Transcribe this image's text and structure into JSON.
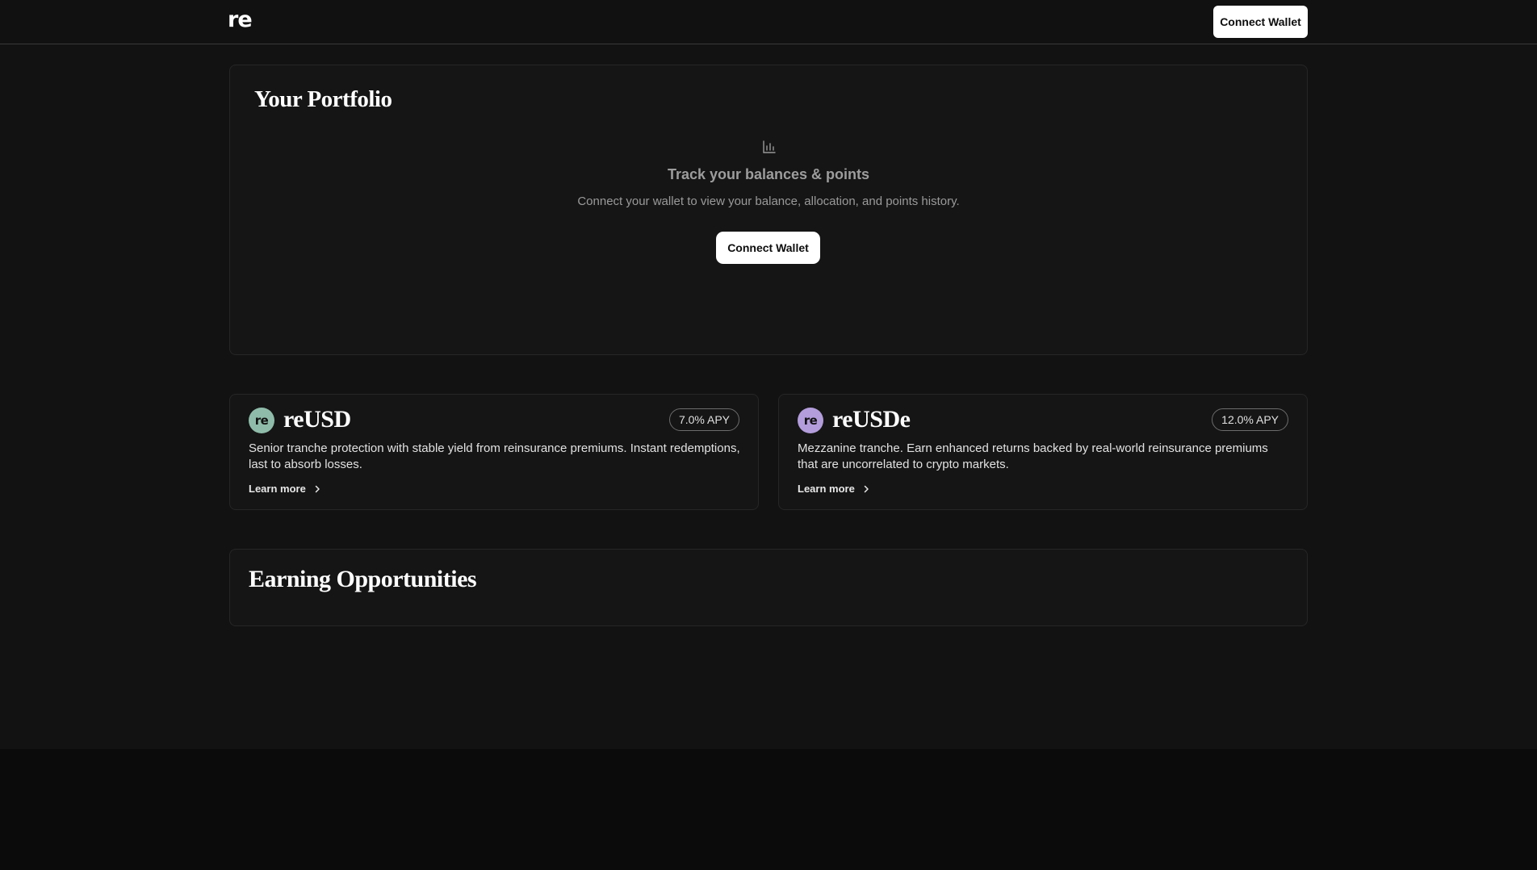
{
  "header": {
    "logo_text": "re",
    "connect_label": "Connect Wallet"
  },
  "portfolio": {
    "title": "Your Portfolio",
    "icon": "bar-chart-icon",
    "empty_title": "Track your balances & points",
    "empty_subtitle": "Connect your wallet to view your balance, allocation, and points history.",
    "connect_label": "Connect Wallet"
  },
  "tokens": [
    {
      "logo_text": "re",
      "logo_color": "#8fbcaa",
      "name": "reUSD",
      "apy": "7.0% APY",
      "description": "Senior tranche protection with stable yield from reinsurance premiums. Instant redemptions, last to absorb losses.",
      "learn_more": "Learn more"
    },
    {
      "logo_text": "re",
      "logo_color": "#b39ddb",
      "name": "reUSDe",
      "apy": "12.0% APY",
      "description": "Mezzanine tranche. Earn enhanced returns backed by real-world reinsurance premiums that are uncorrelated to crypto markets.",
      "learn_more": "Learn more"
    }
  ],
  "earning": {
    "title": "Earning Opportunities"
  }
}
